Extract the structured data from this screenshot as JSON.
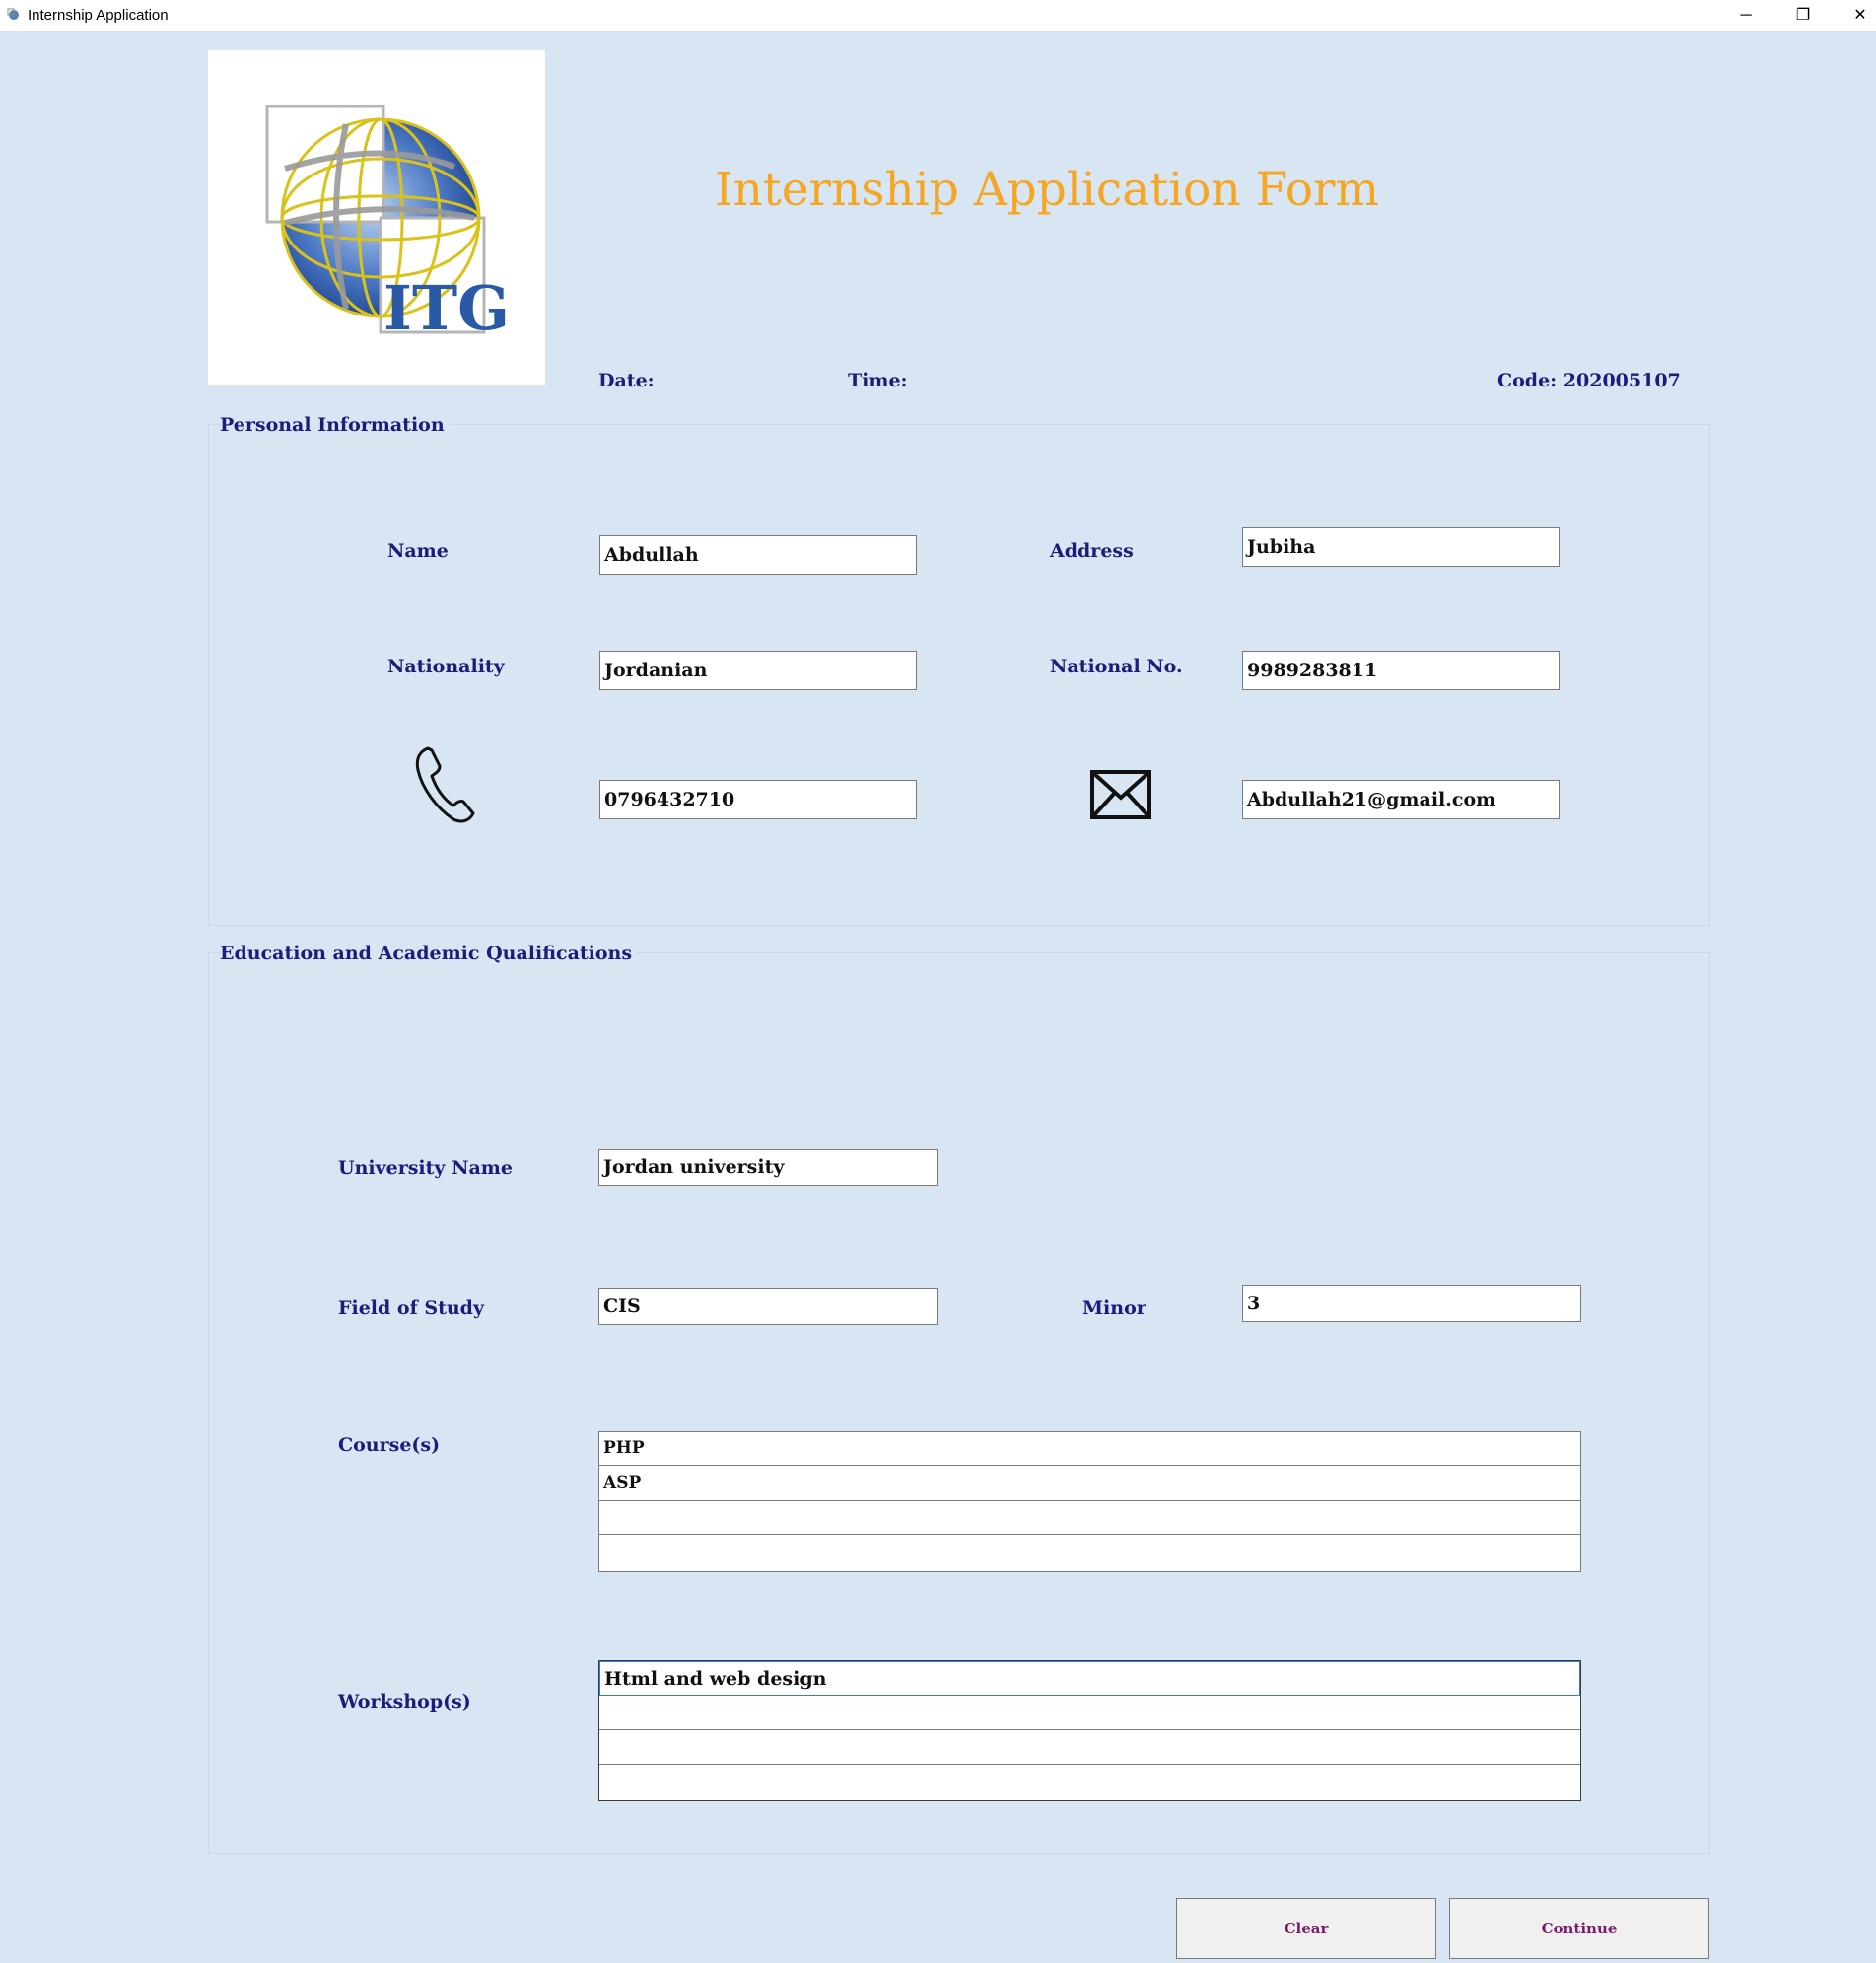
{
  "window": {
    "title": "Internship Application",
    "controls": {
      "minimize": "─",
      "maximize": "❐",
      "close": "✕"
    }
  },
  "header": {
    "logo_text": "ITG",
    "form_title": "Internship Application Form",
    "date_label": "Date:",
    "time_label": "Time:",
    "code_label": "Code: 202005107"
  },
  "personal": {
    "title": "Personal Information",
    "name_label": "Name",
    "name_value": "Abdullah",
    "address_label": "Address",
    "address_value": "Jubiha",
    "nationality_label": "Nationality",
    "nationality_value": "Jordanian",
    "national_no_label": "National No.",
    "national_no_value": "9989283811",
    "phone_icon": "phone-icon",
    "phone_value": "0796432710",
    "email_icon": "envelope-icon",
    "email_value": "Abdullah21@gmail.com"
  },
  "education": {
    "title": "Education and Academic Qualifications",
    "university_label": "University Name",
    "university_value": "Jordan university",
    "field_label": "Field of Study",
    "field_value": "CIS",
    "minor_label": "Minor",
    "minor_value": "3",
    "courses_label": "Course(s)",
    "courses": [
      "PHP",
      "ASP",
      "",
      ""
    ],
    "workshops_label": "Workshop(s)",
    "workshops": [
      "Html and web design",
      "",
      "",
      ""
    ]
  },
  "buttons": {
    "clear": "Clear",
    "continue": "Continue"
  },
  "colors": {
    "background": "#d8e5f3",
    "title_orange": "#f5a623",
    "label_navy": "#1c1c7a",
    "button_text": "#7a1b6e"
  }
}
